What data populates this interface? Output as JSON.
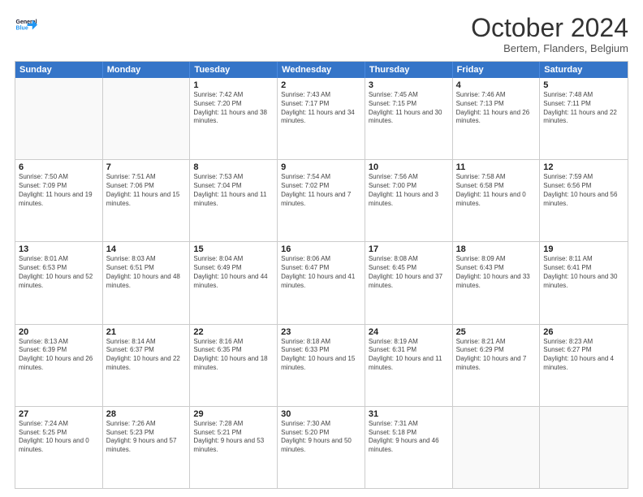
{
  "header": {
    "logo_line1": "General",
    "logo_line2": "Blue",
    "month_title": "October 2024",
    "location": "Bertem, Flanders, Belgium"
  },
  "days_of_week": [
    "Sunday",
    "Monday",
    "Tuesday",
    "Wednesday",
    "Thursday",
    "Friday",
    "Saturday"
  ],
  "weeks": [
    [
      {
        "day": "",
        "detail": ""
      },
      {
        "day": "",
        "detail": ""
      },
      {
        "day": "1",
        "detail": "Sunrise: 7:42 AM\nSunset: 7:20 PM\nDaylight: 11 hours and 38 minutes."
      },
      {
        "day": "2",
        "detail": "Sunrise: 7:43 AM\nSunset: 7:17 PM\nDaylight: 11 hours and 34 minutes."
      },
      {
        "day": "3",
        "detail": "Sunrise: 7:45 AM\nSunset: 7:15 PM\nDaylight: 11 hours and 30 minutes."
      },
      {
        "day": "4",
        "detail": "Sunrise: 7:46 AM\nSunset: 7:13 PM\nDaylight: 11 hours and 26 minutes."
      },
      {
        "day": "5",
        "detail": "Sunrise: 7:48 AM\nSunset: 7:11 PM\nDaylight: 11 hours and 22 minutes."
      }
    ],
    [
      {
        "day": "6",
        "detail": "Sunrise: 7:50 AM\nSunset: 7:09 PM\nDaylight: 11 hours and 19 minutes."
      },
      {
        "day": "7",
        "detail": "Sunrise: 7:51 AM\nSunset: 7:06 PM\nDaylight: 11 hours and 15 minutes."
      },
      {
        "day": "8",
        "detail": "Sunrise: 7:53 AM\nSunset: 7:04 PM\nDaylight: 11 hours and 11 minutes."
      },
      {
        "day": "9",
        "detail": "Sunrise: 7:54 AM\nSunset: 7:02 PM\nDaylight: 11 hours and 7 minutes."
      },
      {
        "day": "10",
        "detail": "Sunrise: 7:56 AM\nSunset: 7:00 PM\nDaylight: 11 hours and 3 minutes."
      },
      {
        "day": "11",
        "detail": "Sunrise: 7:58 AM\nSunset: 6:58 PM\nDaylight: 11 hours and 0 minutes."
      },
      {
        "day": "12",
        "detail": "Sunrise: 7:59 AM\nSunset: 6:56 PM\nDaylight: 10 hours and 56 minutes."
      }
    ],
    [
      {
        "day": "13",
        "detail": "Sunrise: 8:01 AM\nSunset: 6:53 PM\nDaylight: 10 hours and 52 minutes."
      },
      {
        "day": "14",
        "detail": "Sunrise: 8:03 AM\nSunset: 6:51 PM\nDaylight: 10 hours and 48 minutes."
      },
      {
        "day": "15",
        "detail": "Sunrise: 8:04 AM\nSunset: 6:49 PM\nDaylight: 10 hours and 44 minutes."
      },
      {
        "day": "16",
        "detail": "Sunrise: 8:06 AM\nSunset: 6:47 PM\nDaylight: 10 hours and 41 minutes."
      },
      {
        "day": "17",
        "detail": "Sunrise: 8:08 AM\nSunset: 6:45 PM\nDaylight: 10 hours and 37 minutes."
      },
      {
        "day": "18",
        "detail": "Sunrise: 8:09 AM\nSunset: 6:43 PM\nDaylight: 10 hours and 33 minutes."
      },
      {
        "day": "19",
        "detail": "Sunrise: 8:11 AM\nSunset: 6:41 PM\nDaylight: 10 hours and 30 minutes."
      }
    ],
    [
      {
        "day": "20",
        "detail": "Sunrise: 8:13 AM\nSunset: 6:39 PM\nDaylight: 10 hours and 26 minutes."
      },
      {
        "day": "21",
        "detail": "Sunrise: 8:14 AM\nSunset: 6:37 PM\nDaylight: 10 hours and 22 minutes."
      },
      {
        "day": "22",
        "detail": "Sunrise: 8:16 AM\nSunset: 6:35 PM\nDaylight: 10 hours and 18 minutes."
      },
      {
        "day": "23",
        "detail": "Sunrise: 8:18 AM\nSunset: 6:33 PM\nDaylight: 10 hours and 15 minutes."
      },
      {
        "day": "24",
        "detail": "Sunrise: 8:19 AM\nSunset: 6:31 PM\nDaylight: 10 hours and 11 minutes."
      },
      {
        "day": "25",
        "detail": "Sunrise: 8:21 AM\nSunset: 6:29 PM\nDaylight: 10 hours and 7 minutes."
      },
      {
        "day": "26",
        "detail": "Sunrise: 8:23 AM\nSunset: 6:27 PM\nDaylight: 10 hours and 4 minutes."
      }
    ],
    [
      {
        "day": "27",
        "detail": "Sunrise: 7:24 AM\nSunset: 5:25 PM\nDaylight: 10 hours and 0 minutes."
      },
      {
        "day": "28",
        "detail": "Sunrise: 7:26 AM\nSunset: 5:23 PM\nDaylight: 9 hours and 57 minutes."
      },
      {
        "day": "29",
        "detail": "Sunrise: 7:28 AM\nSunset: 5:21 PM\nDaylight: 9 hours and 53 minutes."
      },
      {
        "day": "30",
        "detail": "Sunrise: 7:30 AM\nSunset: 5:20 PM\nDaylight: 9 hours and 50 minutes."
      },
      {
        "day": "31",
        "detail": "Sunrise: 7:31 AM\nSunset: 5:18 PM\nDaylight: 9 hours and 46 minutes."
      },
      {
        "day": "",
        "detail": ""
      },
      {
        "day": "",
        "detail": ""
      }
    ]
  ]
}
